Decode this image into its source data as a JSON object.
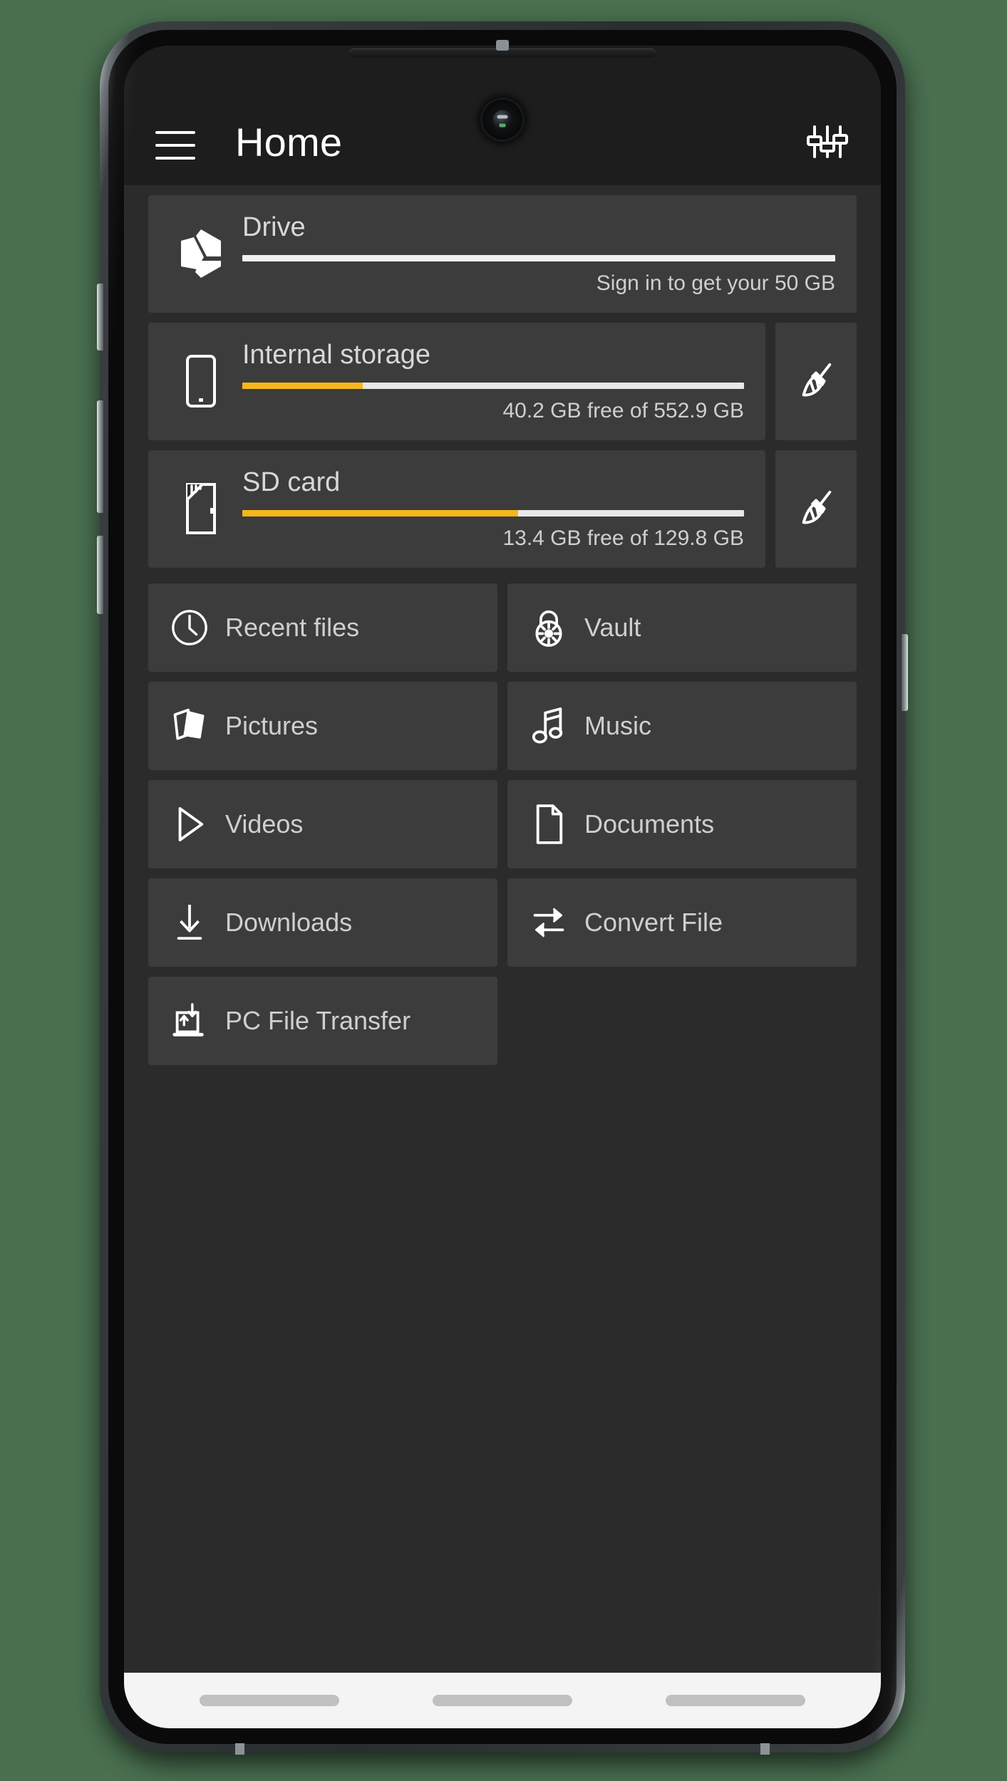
{
  "background_color": "#4a7050",
  "device": {
    "name": "android-phone-mockup",
    "frame_color": "#2a2d2f",
    "screen_bg": "#2b2b2b"
  },
  "appbar": {
    "title": "Home",
    "menu_icon": "hamburger-menu-icon",
    "settings_icon": "sliders-settings-icon",
    "background": "#1d1d1d"
  },
  "storage": {
    "drive": {
      "icon": "drive-hexagon-icon",
      "name": "Drive",
      "subtitle": "Sign in to get your 50 GB",
      "progress_percent": 0,
      "track_color": "#f1f1f1"
    },
    "internal": {
      "icon": "phone-icon",
      "name": "Internal storage",
      "subtitle": "40.2 GB free of 552.9 GB",
      "progress_percent": 24,
      "fill_color": "#f5b81a",
      "track_color": "#e8e8e8",
      "clean_icon": "broom-clean-icon"
    },
    "sdcard": {
      "icon": "sd-card-icon",
      "name": "SD card",
      "subtitle": "13.4 GB free of 129.8 GB",
      "progress_percent": 55,
      "fill_color": "#f5b81a",
      "track_color": "#e8e8e8",
      "clean_icon": "broom-clean-icon"
    }
  },
  "tiles": [
    {
      "label": "Recent files",
      "icon": "clock-icon"
    },
    {
      "label": "Vault",
      "icon": "padlock-icon"
    },
    {
      "label": "Pictures",
      "icon": "pictures-icon"
    },
    {
      "label": "Music",
      "icon": "music-note-icon"
    },
    {
      "label": "Videos",
      "icon": "play-triangle-icon"
    },
    {
      "label": "Documents",
      "icon": "document-page-icon"
    },
    {
      "label": "Downloads",
      "icon": "download-arrow-icon"
    },
    {
      "label": "Convert File",
      "icon": "convert-swap-icon"
    },
    {
      "label": "PC File Transfer",
      "icon": "pc-file-transfer-icon"
    }
  ],
  "navbar": {
    "background": "#f4f4f4",
    "pill_color": "#c0c0c0",
    "pills": [
      "nav-back-pill",
      "nav-home-pill",
      "nav-recents-pill"
    ]
  }
}
